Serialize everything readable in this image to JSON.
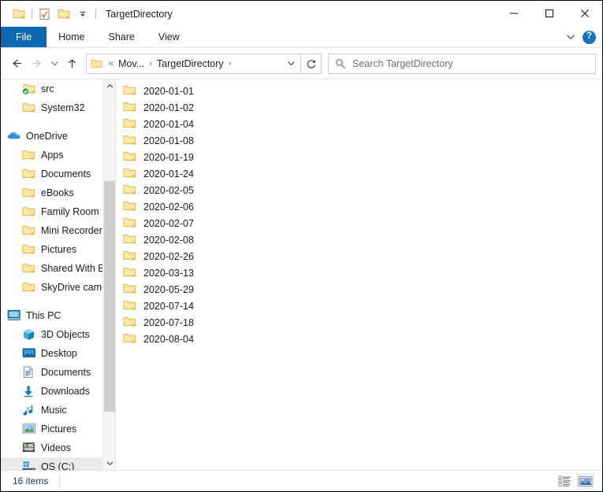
{
  "window": {
    "title": "TargetDirectory",
    "quick_access": [
      {
        "name": "new-folder-icon",
        "icon": "folder"
      },
      {
        "name": "properties-icon",
        "icon": "properties"
      },
      {
        "name": "folder-icon",
        "icon": "folder"
      },
      {
        "name": "customize-quick-access-dropdown",
        "icon": "chevron-down"
      }
    ],
    "controls": {
      "minimize": "—",
      "maximize": "☐",
      "close": "✕"
    }
  },
  "ribbon": {
    "tabs": [
      {
        "label": "File",
        "active": true
      },
      {
        "label": "Home",
        "active": false
      },
      {
        "label": "Share",
        "active": false
      },
      {
        "label": "View",
        "active": false
      }
    ],
    "minimize_ribbon_icon": "chevron-down-icon",
    "help_label": "?"
  },
  "nav": {
    "back_icon": "arrow-left-icon",
    "forward_icon": "arrow-right-icon",
    "recent_icon": "chevron-down-icon",
    "up_icon": "arrow-up-icon",
    "refresh_icon": "refresh-icon",
    "dropdown_icon": "chevron-down-icon",
    "breadcrumb": {
      "overflow": "«",
      "items": [
        {
          "label": "Mov...",
          "sep": "›"
        },
        {
          "label": "TargetDirectory",
          "sep": "›"
        }
      ]
    }
  },
  "search": {
    "icon": "search-icon",
    "placeholder": "Search TargetDirectory",
    "value": ""
  },
  "sidebar": {
    "scroll": {
      "up_arrow": "⮝",
      "down_arrow": "⮟",
      "thumb_top_pct": 26,
      "thumb_height_pct": 59
    },
    "items": [
      {
        "label": "src",
        "icon": "folder-synced",
        "level": "child",
        "selected": false,
        "gap_before": false
      },
      {
        "label": "System32",
        "icon": "folder",
        "level": "child",
        "selected": false,
        "gap_before": false
      },
      {
        "label": "OneDrive",
        "icon": "cloud",
        "level": "root",
        "selected": false,
        "gap_before": true
      },
      {
        "label": "Apps",
        "icon": "folder",
        "level": "child",
        "selected": false,
        "gap_before": false
      },
      {
        "label": "Documents",
        "icon": "folder",
        "level": "child",
        "selected": false,
        "gap_before": false
      },
      {
        "label": "eBooks",
        "icon": "folder",
        "level": "child",
        "selected": false,
        "gap_before": false
      },
      {
        "label": "Family Room",
        "icon": "folder",
        "level": "child",
        "selected": false,
        "gap_before": false
      },
      {
        "label": "Mini Recorder",
        "icon": "folder",
        "level": "child",
        "selected": false,
        "gap_before": false
      },
      {
        "label": "Pictures",
        "icon": "folder",
        "level": "child",
        "selected": false,
        "gap_before": false
      },
      {
        "label": "Shared With Eve",
        "icon": "folder",
        "level": "child",
        "selected": false,
        "gap_before": false
      },
      {
        "label": "SkyDrive camera",
        "icon": "folder",
        "level": "child",
        "selected": false,
        "gap_before": false
      },
      {
        "label": "This PC",
        "icon": "monitor",
        "level": "root",
        "selected": false,
        "gap_before": true
      },
      {
        "label": "3D Objects",
        "icon": "cube",
        "level": "child",
        "selected": false,
        "gap_before": false
      },
      {
        "label": "Desktop",
        "icon": "desktop",
        "level": "child",
        "selected": false,
        "gap_before": false
      },
      {
        "label": "Documents",
        "icon": "document",
        "level": "child",
        "selected": false,
        "gap_before": false
      },
      {
        "label": "Downloads",
        "icon": "download",
        "level": "child",
        "selected": false,
        "gap_before": false
      },
      {
        "label": "Music",
        "icon": "music",
        "level": "child",
        "selected": false,
        "gap_before": false
      },
      {
        "label": "Pictures",
        "icon": "picture",
        "level": "child",
        "selected": false,
        "gap_before": false
      },
      {
        "label": "Videos",
        "icon": "video",
        "level": "child",
        "selected": false,
        "gap_before": false
      },
      {
        "label": "OS (C:)",
        "icon": "drive",
        "level": "child",
        "selected": true,
        "gap_before": false
      }
    ]
  },
  "filelist": {
    "items": [
      {
        "name": "2020-01-01",
        "icon": "folder"
      },
      {
        "name": "2020-01-02",
        "icon": "folder"
      },
      {
        "name": "2020-01-04",
        "icon": "folder"
      },
      {
        "name": "2020-01-08",
        "icon": "folder"
      },
      {
        "name": "2020-01-19",
        "icon": "folder"
      },
      {
        "name": "2020-01-24",
        "icon": "folder"
      },
      {
        "name": "2020-02-05",
        "icon": "folder"
      },
      {
        "name": "2020-02-06",
        "icon": "folder"
      },
      {
        "name": "2020-02-07",
        "icon": "folder"
      },
      {
        "name": "2020-02-08",
        "icon": "folder"
      },
      {
        "name": "2020-02-26",
        "icon": "folder"
      },
      {
        "name": "2020-03-13",
        "icon": "folder"
      },
      {
        "name": "2020-05-29",
        "icon": "folder"
      },
      {
        "name": "2020-07-14",
        "icon": "folder"
      },
      {
        "name": "2020-07-18",
        "icon": "folder"
      },
      {
        "name": "2020-08-04",
        "icon": "folder"
      }
    ]
  },
  "statusbar": {
    "item_count": "16 items",
    "views": [
      {
        "name": "details-view-button",
        "icon": "details",
        "active": false
      },
      {
        "name": "large-icons-view-button",
        "icon": "thumbnails",
        "active": true
      }
    ]
  },
  "colors": {
    "accent": "#0e68b0",
    "folder_fill": "#fce9a8",
    "folder_stroke": "#e3b54a",
    "selection": "#eaeaea",
    "status_text": "#1a3c6e",
    "help_blue": "#1572bb"
  }
}
